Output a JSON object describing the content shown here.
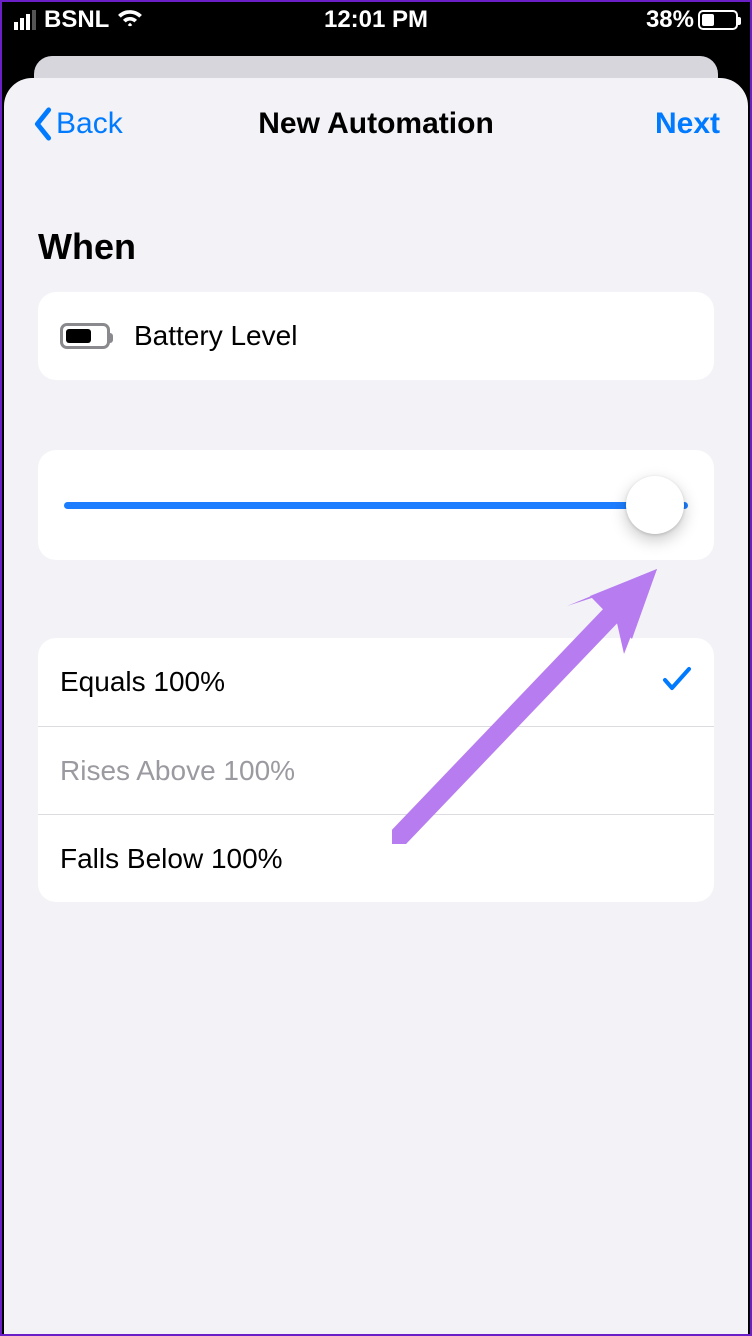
{
  "statusbar": {
    "carrier": "BSNL",
    "time": "12:01 PM",
    "battery_percent": "38%"
  },
  "nav": {
    "back_label": "Back",
    "title": "New Automation",
    "next_label": "Next"
  },
  "section_header": "When",
  "trigger": {
    "label": "Battery Level"
  },
  "slider": {
    "value_percent": 100
  },
  "options": [
    {
      "label": "Equals 100%",
      "selected": true,
      "enabled": true
    },
    {
      "label": "Rises Above 100%",
      "selected": false,
      "enabled": false
    },
    {
      "label": "Falls Below 100%",
      "selected": false,
      "enabled": true
    }
  ],
  "annotation": {
    "arrow_color": "#b77cf0"
  }
}
